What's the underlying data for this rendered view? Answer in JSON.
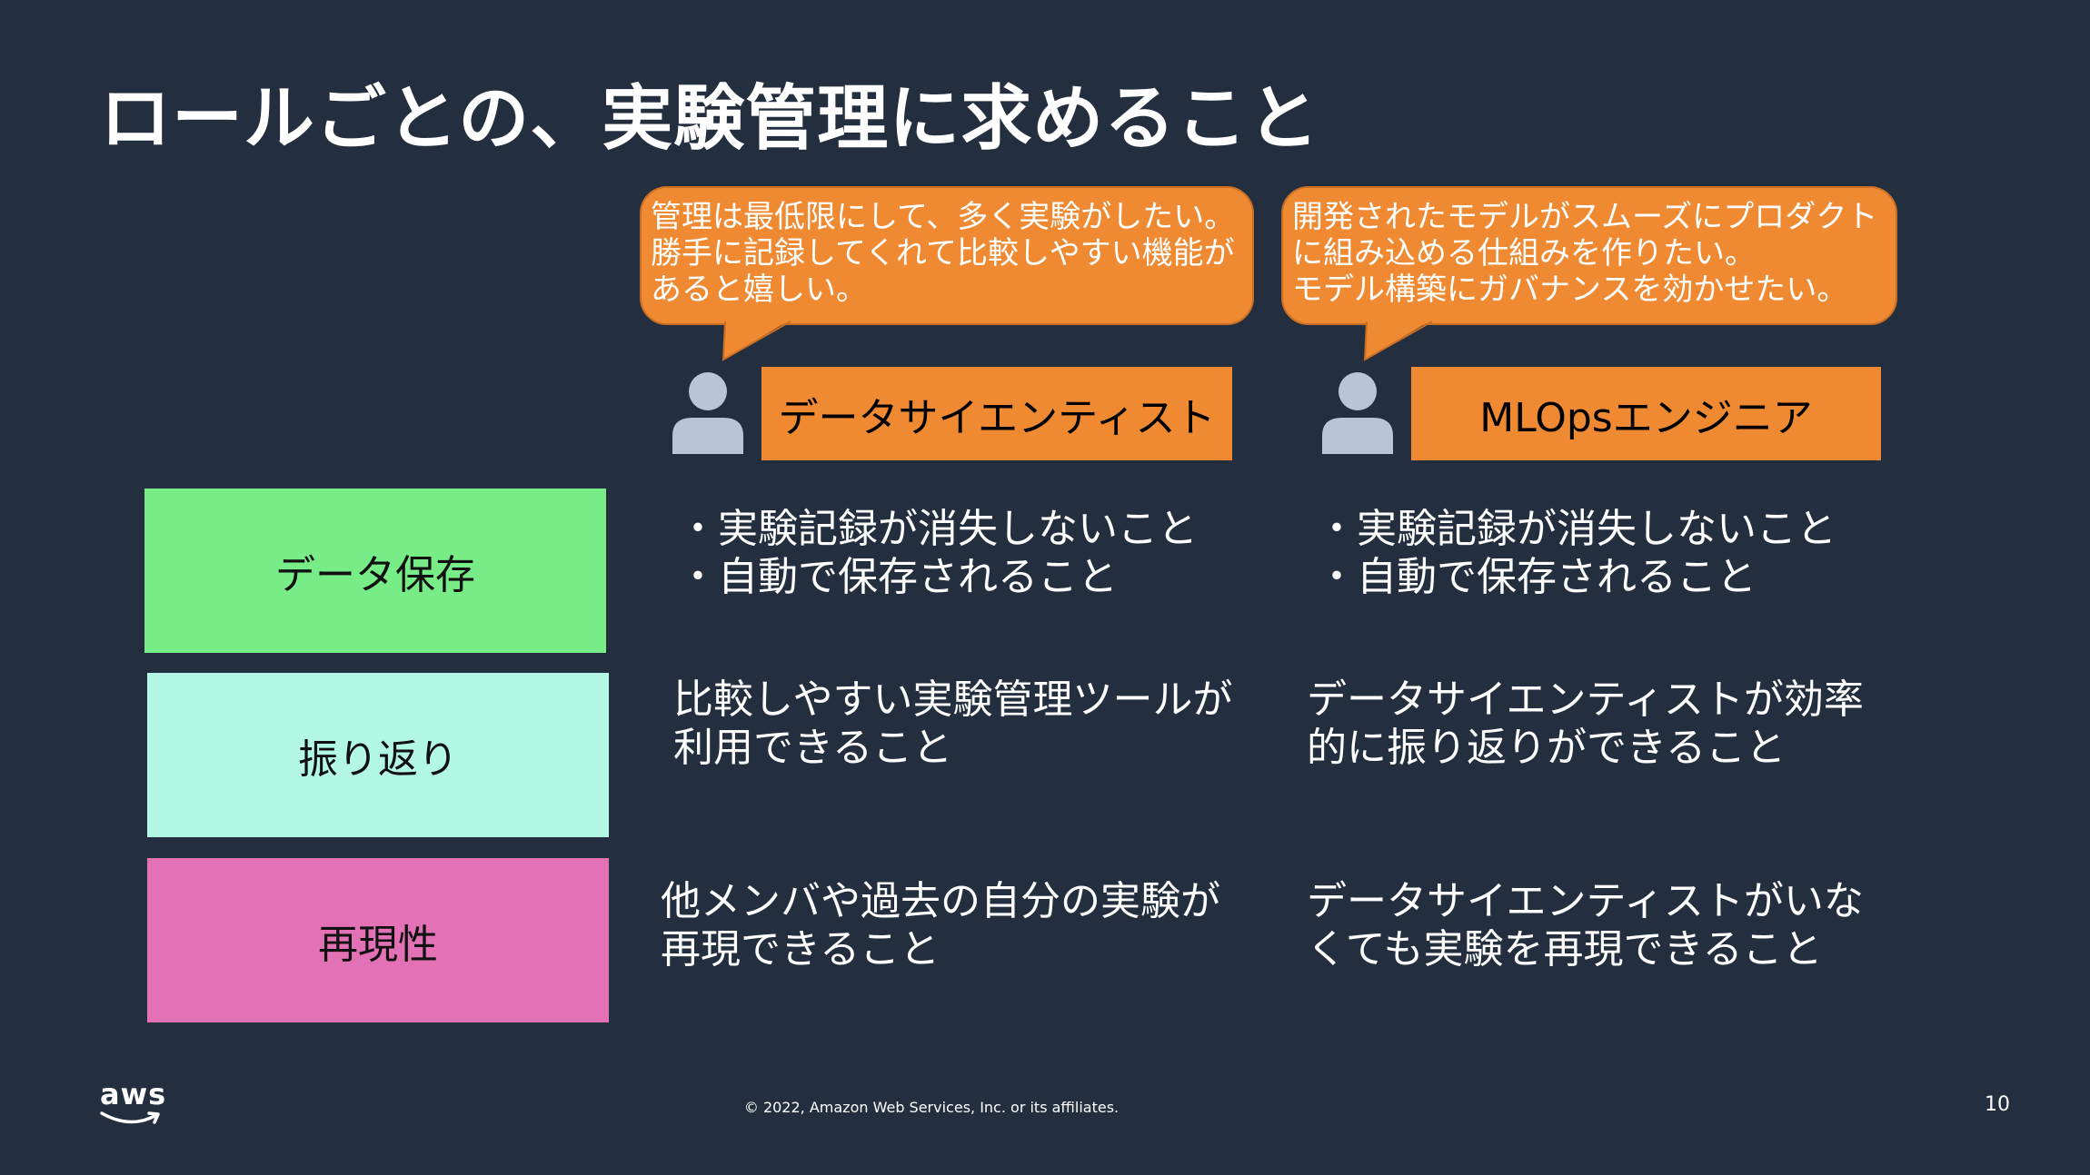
{
  "slide": {
    "title": "ロールごとの、実験管理に求めること",
    "page_number": "10",
    "copyright": "© 2022, Amazon Web Services, Inc. or its affiliates.",
    "logo_text": "aws"
  },
  "colors": {
    "background": "#232f3e",
    "orange": "#ef8a33",
    "green": "#77ec87",
    "mint": "#b3f8e5",
    "pink": "#e272b5",
    "icon": "#b9c4d6"
  },
  "roles": [
    {
      "name": "データサイエンティスト",
      "icon": "person-icon",
      "speech": [
        "管理は最低限にして、多く実験がしたい。",
        "勝手に記録してくれて比較しやすい機能が",
        "あると嬉しい。"
      ]
    },
    {
      "name": "MLOpsエンジニア",
      "icon": "person-icon",
      "speech": [
        "開発されたモデルがスムーズにプロダクト",
        "に組み込める仕組みを作りたい。",
        "モデル構築にガバナンスを効かせたい。"
      ]
    }
  ],
  "categories": [
    {
      "label": "データ保存",
      "ds": [
        "・実験記録が消失しないこと",
        "・自動で保存されること"
      ],
      "mlops": [
        "・実験記録が消失しないこと",
        "・自動で保存されること"
      ]
    },
    {
      "label": "振り返り",
      "ds": [
        "比較しやすい実験管理ツールが",
        "利用できること"
      ],
      "mlops": [
        "データサイエンティストが効率",
        "的に振り返りができること"
      ]
    },
    {
      "label": "再現性",
      "ds": [
        "他メンバや過去の自分の実験が",
        "再現できること"
      ],
      "mlops": [
        "データサイエンティストがいな",
        "くても実験を再現できること"
      ]
    }
  ]
}
